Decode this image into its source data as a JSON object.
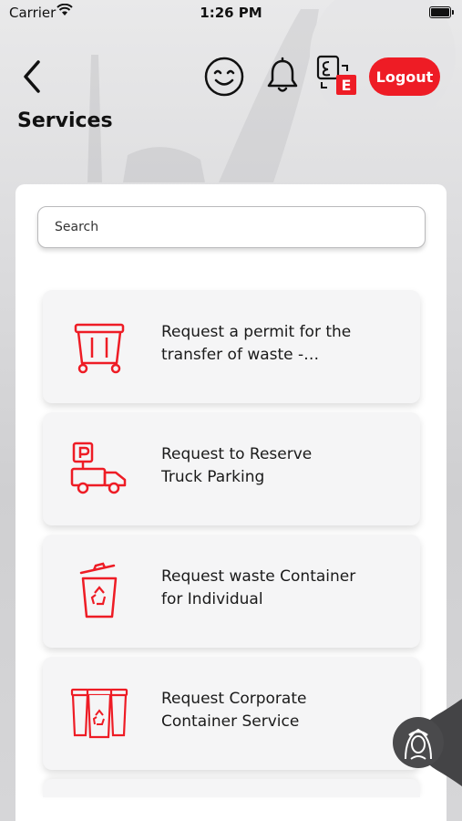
{
  "status_bar": {
    "carrier": "Carrier",
    "time": "1:26 PM"
  },
  "header": {
    "back_icon": "chevron-left-icon",
    "feedback_icon": "smiley-icon",
    "notifications_icon": "bell-icon",
    "language_icon": "language-switch-icon",
    "language_badge": "E",
    "logout_label": "Logout"
  },
  "page": {
    "title": "Services"
  },
  "search": {
    "placeholder": "Search"
  },
  "services": [
    {
      "label": "Request a permit for the transfer of waste - Establishment",
      "icon": "waste-bin-cart-icon"
    },
    {
      "label": "Request to Reserve\nTruck Parking",
      "icon": "truck-parking-icon"
    },
    {
      "label": "Request waste Container\nfor Individual",
      "icon": "recycle-bin-icon"
    },
    {
      "label": "Request Corporate\nContainer Service",
      "icon": "corporate-containers-icon"
    }
  ],
  "assistant": {
    "icon": "virtual-assistant-icon"
  },
  "colors": {
    "accent": "#ee1c25",
    "card": "#f5f5f6",
    "panel": "#ffffff"
  }
}
